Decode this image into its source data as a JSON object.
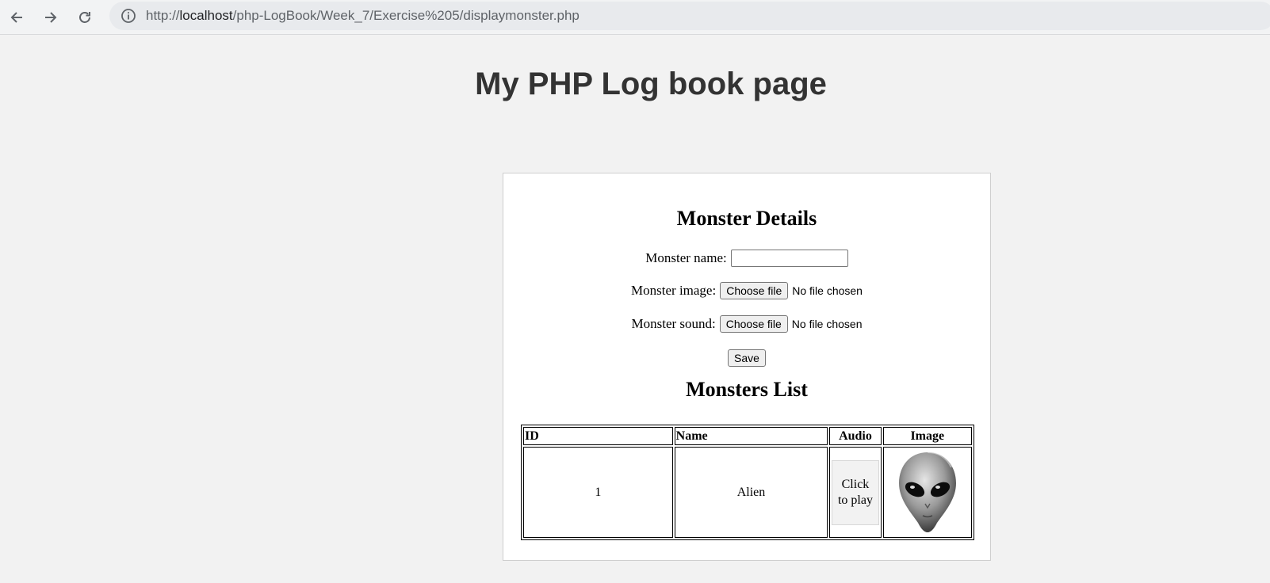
{
  "browser": {
    "url_scheme": "http://",
    "url_host": "localhost",
    "url_path": "/php-LogBook/Week_7/Exercise%205/displaymonster.php"
  },
  "page": {
    "title": "My PHP Log book page"
  },
  "form": {
    "heading": "Monster Details",
    "name_label": "Monster name:",
    "name_value": "",
    "image_label": "Monster image:",
    "image_button": "Choose file",
    "image_status": "No file chosen",
    "sound_label": "Monster sound:",
    "sound_button": "Choose file",
    "sound_status": "No file chosen",
    "save_label": "Save"
  },
  "list": {
    "heading": "Monsters List",
    "columns": [
      "ID",
      "Name",
      "Audio",
      "Image"
    ],
    "rows": [
      {
        "id": "1",
        "name": "Alien",
        "audio_label": "Click to play",
        "image": "alien-head"
      }
    ]
  }
}
